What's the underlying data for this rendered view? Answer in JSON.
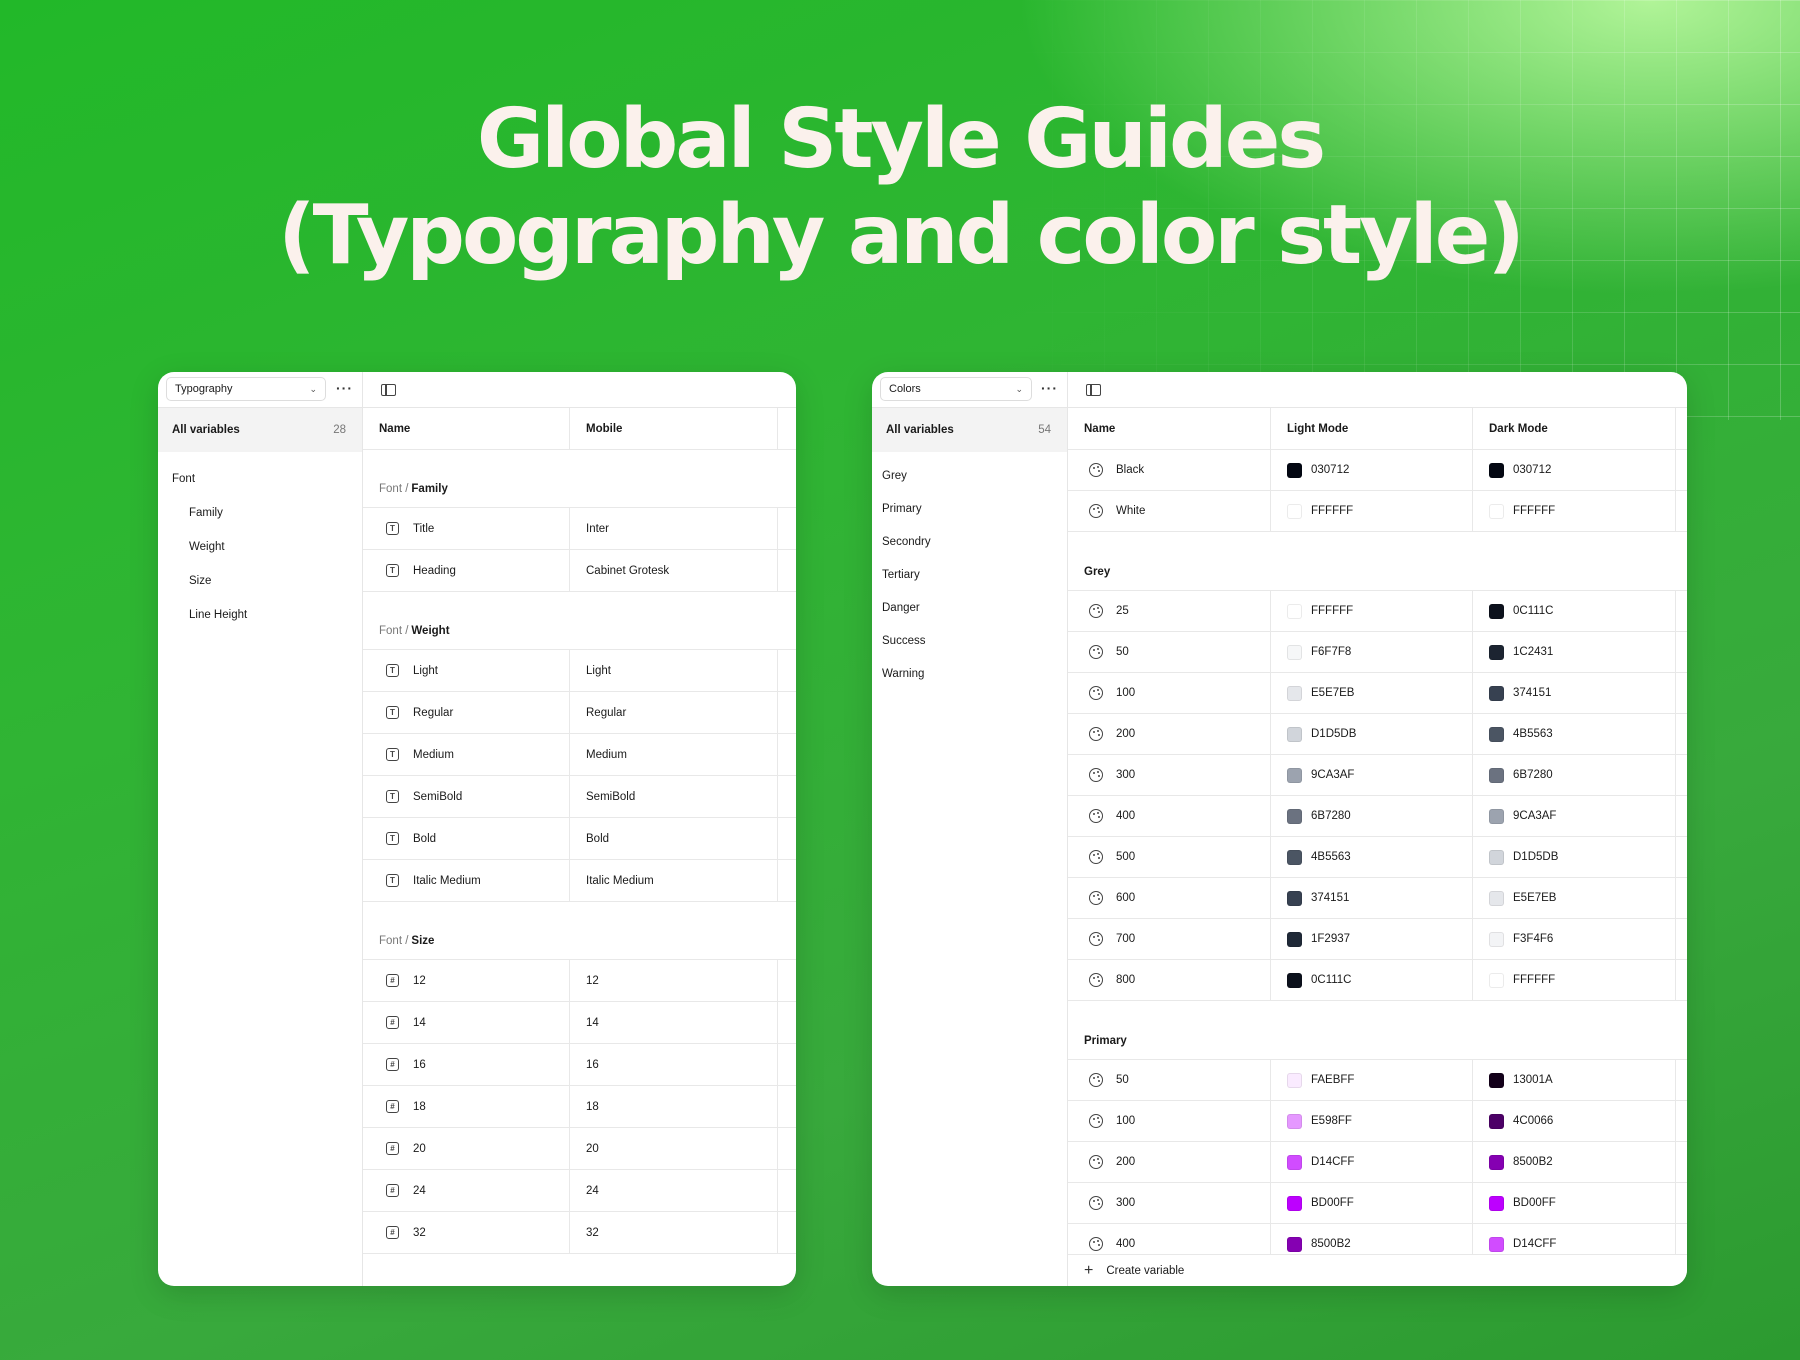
{
  "headline": {
    "line1": "Global Style Guides",
    "line2": "(Typography and color style)"
  },
  "typography_panel": {
    "collection": "Typography",
    "all_variables_label": "All variables",
    "all_variables_count": "28",
    "sidebar": [
      {
        "label": "Font",
        "sub": false
      },
      {
        "label": "Family",
        "sub": true
      },
      {
        "label": "Weight",
        "sub": true
      },
      {
        "label": "Size",
        "sub": true
      },
      {
        "label": "Line Height",
        "sub": true
      }
    ],
    "columns": [
      "Name",
      "Mobile"
    ],
    "groups": [
      {
        "prefix": "Font /",
        "name": "Family",
        "icon": "text-icon",
        "rows": [
          {
            "name": "Title",
            "value": "Inter"
          },
          {
            "name": "Heading",
            "value": "Cabinet Grotesk"
          }
        ]
      },
      {
        "prefix": "Font /",
        "name": "Weight",
        "icon": "text-icon",
        "rows": [
          {
            "name": "Light",
            "value": "Light"
          },
          {
            "name": "Regular",
            "value": "Regular"
          },
          {
            "name": "Medium",
            "value": "Medium"
          },
          {
            "name": "SemiBold",
            "value": "SemiBold"
          },
          {
            "name": "Bold",
            "value": "Bold"
          },
          {
            "name": "Italic Medium",
            "value": "Italic Medium"
          }
        ]
      },
      {
        "prefix": "Font /",
        "name": "Size",
        "icon": "number-icon",
        "rows": [
          {
            "name": "12",
            "value": "12"
          },
          {
            "name": "14",
            "value": "14"
          },
          {
            "name": "16",
            "value": "16"
          },
          {
            "name": "18",
            "value": "18"
          },
          {
            "name": "20",
            "value": "20"
          },
          {
            "name": "24",
            "value": "24"
          },
          {
            "name": "32",
            "value": "32"
          }
        ]
      }
    ]
  },
  "colors_panel": {
    "collection": "Colors",
    "all_variables_label": "All variables",
    "all_variables_count": "54",
    "sidebar": [
      "Grey",
      "Primary",
      "Secondry",
      "Tertiary",
      "Danger",
      "Success",
      "Warning"
    ],
    "columns": [
      "Name",
      "Light Mode",
      "Dark Mode"
    ],
    "top_rows": [
      {
        "name": "Black",
        "light": "030712",
        "dark": "030712"
      },
      {
        "name": "White",
        "light": "FFFFFF",
        "dark": "FFFFFF"
      }
    ],
    "groups": [
      {
        "name": "Grey",
        "rows": [
          {
            "name": "25",
            "light": "FFFFFF",
            "dark": "0C111C"
          },
          {
            "name": "50",
            "light": "F6F7F8",
            "dark": "1C2431"
          },
          {
            "name": "100",
            "light": "E5E7EB",
            "dark": "374151"
          },
          {
            "name": "200",
            "light": "D1D5DB",
            "dark": "4B5563"
          },
          {
            "name": "300",
            "light": "9CA3AF",
            "dark": "6B7280"
          },
          {
            "name": "400",
            "light": "6B7280",
            "dark": "9CA3AF"
          },
          {
            "name": "500",
            "light": "4B5563",
            "dark": "D1D5DB"
          },
          {
            "name": "600",
            "light": "374151",
            "dark": "E5E7EB"
          },
          {
            "name": "700",
            "light": "1F2937",
            "dark": "F3F4F6"
          },
          {
            "name": "800",
            "light": "0C111C",
            "dark": "FFFFFF"
          }
        ]
      },
      {
        "name": "Primary",
        "rows": [
          {
            "name": "50",
            "light": "FAEBFF",
            "dark": "13001A"
          },
          {
            "name": "100",
            "light": "E598FF",
            "dark": "4C0066"
          },
          {
            "name": "200",
            "light": "D14CFF",
            "dark": "8500B2"
          },
          {
            "name": "300",
            "light": "BD00FF",
            "dark": "BD00FF"
          },
          {
            "name": "400",
            "light": "8500B2",
            "dark": "D14CFF"
          }
        ]
      }
    ],
    "create_label": "Create variable"
  }
}
